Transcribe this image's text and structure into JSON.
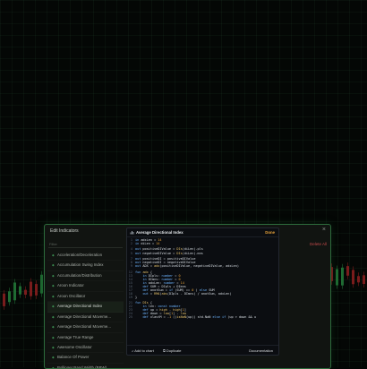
{
  "panel": {
    "title": "Edit Indicators",
    "close_glyph": "×",
    "filter_placeholder": "Filter",
    "delete_all_label": "Delete All"
  },
  "indicators": [
    "Acceleration/Deceleration",
    "Accumulation Swing Index",
    "Accumulation/Distribution",
    "Aroon Indicator",
    "Aroon Oscillator",
    "Average Directional Index",
    "Average Directional Moveme...",
    "Average Directional Moveme...",
    "Average True Range",
    "Awesome Oscillator",
    "Balance Of Power",
    "Bollinger Band Width (BBW)"
  ],
  "selected_indicator_index": 5,
  "editor": {
    "title": "Average Directional Index",
    "done_label": "Done",
    "add_to_chart_label": "Add to chart",
    "duplicate_label": "Duplicate",
    "documentation_label": "Documentation",
    "code_lines": [
      {
        "n": "1",
        "text": "in adxLen = 14"
      },
      {
        "n": "2",
        "text": "in diLen = 14"
      },
      {
        "n": "",
        "text": ""
      },
      {
        "n": "4",
        "text": "out positiveDIValue = DIs(diLen).pls"
      },
      {
        "n": "5",
        "text": "out negativeDIValue = DIs(diLen).mns"
      },
      {
        "n": "",
        "text": ""
      },
      {
        "n": "7",
        "text": "out positiveDI = positiveDIValue"
      },
      {
        "n": "8",
        "text": "out negativeDI = negativeDIValue"
      },
      {
        "n": "9",
        "text": "out ADX = adx(positiveDIValue, negativeDIValue, adxLen)"
      },
      {
        "n": "",
        "text": ""
      },
      {
        "n": "12",
        "text": "fun adx {"
      },
      {
        "n": "13",
        "text": "    in DIpls: number = 0"
      },
      {
        "n": "14",
        "text": "    in DImns: number = 0"
      },
      {
        "n": "15",
        "text": "    in adxLen: number = 14"
      },
      {
        "n": "16",
        "text": "    def SUM = DIpls + DImns"
      },
      {
        "n": "17",
        "text": "    def anotSum = if (SUM) == 0 ) else SUM"
      },
      {
        "n": "18",
        "text": "    out = RMA(abs(DIpls - DImns) / anotSum, adxLen)"
      },
      {
        "n": "19",
        "text": "}"
      },
      {
        "n": "",
        "text": ""
      },
      {
        "n": "21",
        "text": "fun DIs {"
      },
      {
        "n": "22",
        "text": "    in len: const number"
      },
      {
        "n": "23",
        "text": "    def up = high - high[1]"
      },
      {
        "n": "24",
        "text": "    def down = low[1] - low"
      },
      {
        "n": "25",
        "text": "    def xlastM = -1 ((isNaN(up)) std.NaN else if (up > down && u"
      }
    ]
  },
  "colors": {
    "accent_green": "#2c6a3b",
    "done_orange": "#e8a33a",
    "delete_red": "#c34a4a",
    "keyword_blue": "#6db4ff"
  }
}
